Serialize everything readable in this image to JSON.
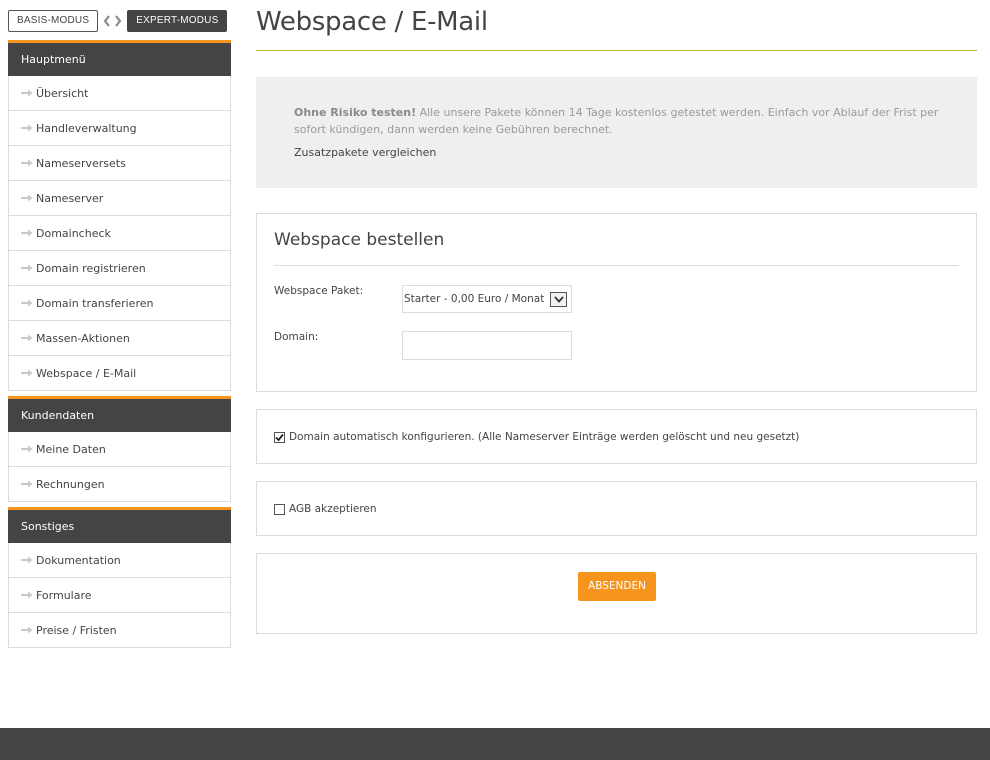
{
  "mode": {
    "basis_label": "BASIS-MODUS",
    "expert_label": "EXPERT-MODUS"
  },
  "sidebar": {
    "groups": [
      {
        "title": "Hauptmenü",
        "items": [
          {
            "label": "Übersicht"
          },
          {
            "label": "Handleverwaltung"
          },
          {
            "label": "Nameserversets"
          },
          {
            "label": "Nameserver"
          },
          {
            "label": "Domaincheck"
          },
          {
            "label": "Domain registrieren"
          },
          {
            "label": "Domain transferieren"
          },
          {
            "label": "Massen-Aktionen"
          },
          {
            "label": "Webspace / E-Mail"
          }
        ]
      },
      {
        "title": "Kundendaten",
        "items": [
          {
            "label": "Meine Daten"
          },
          {
            "label": "Rechnungen"
          }
        ]
      },
      {
        "title": "Sonstiges",
        "items": [
          {
            "label": "Dokumentation"
          },
          {
            "label": "Formulare"
          },
          {
            "label": "Preise / Fristen"
          }
        ]
      }
    ]
  },
  "main": {
    "title": "Webspace / E-Mail",
    "info": {
      "bold": "Ohne Risiko testen!",
      "text": " Alle unsere Pakete können 14 Tage kostenlos getestet werden. Einfach vor Ablauf der Frist per sofort kündigen, dann werden keine Gebühren berechnet.",
      "link": "Zusatzpakete vergleichen"
    },
    "order": {
      "title": "Webspace bestellen",
      "package_label": "Webspace Paket:",
      "package_value": "Starter - 0,00 Euro / Monat",
      "domain_label": "Domain:",
      "domain_value": ""
    },
    "auto_config": {
      "checked": true,
      "label": "Domain automatisch konfigurieren. (Alle Nameserver Einträge werden gelöscht und neu gesetzt)"
    },
    "agb": {
      "checked": false,
      "label": "AGB akzeptieren"
    },
    "submit_label": "ABSENDEN"
  },
  "colors": {
    "accent": "#f7941e",
    "dark": "#444444",
    "rule": "#b5b830"
  },
  "icons": {
    "menu_arrow": "arrow-right-icon",
    "mode_prev": "chevron-left-icon",
    "mode_next": "chevron-right-icon",
    "select": "chevron-down-icon",
    "check": "checkmark-icon"
  }
}
